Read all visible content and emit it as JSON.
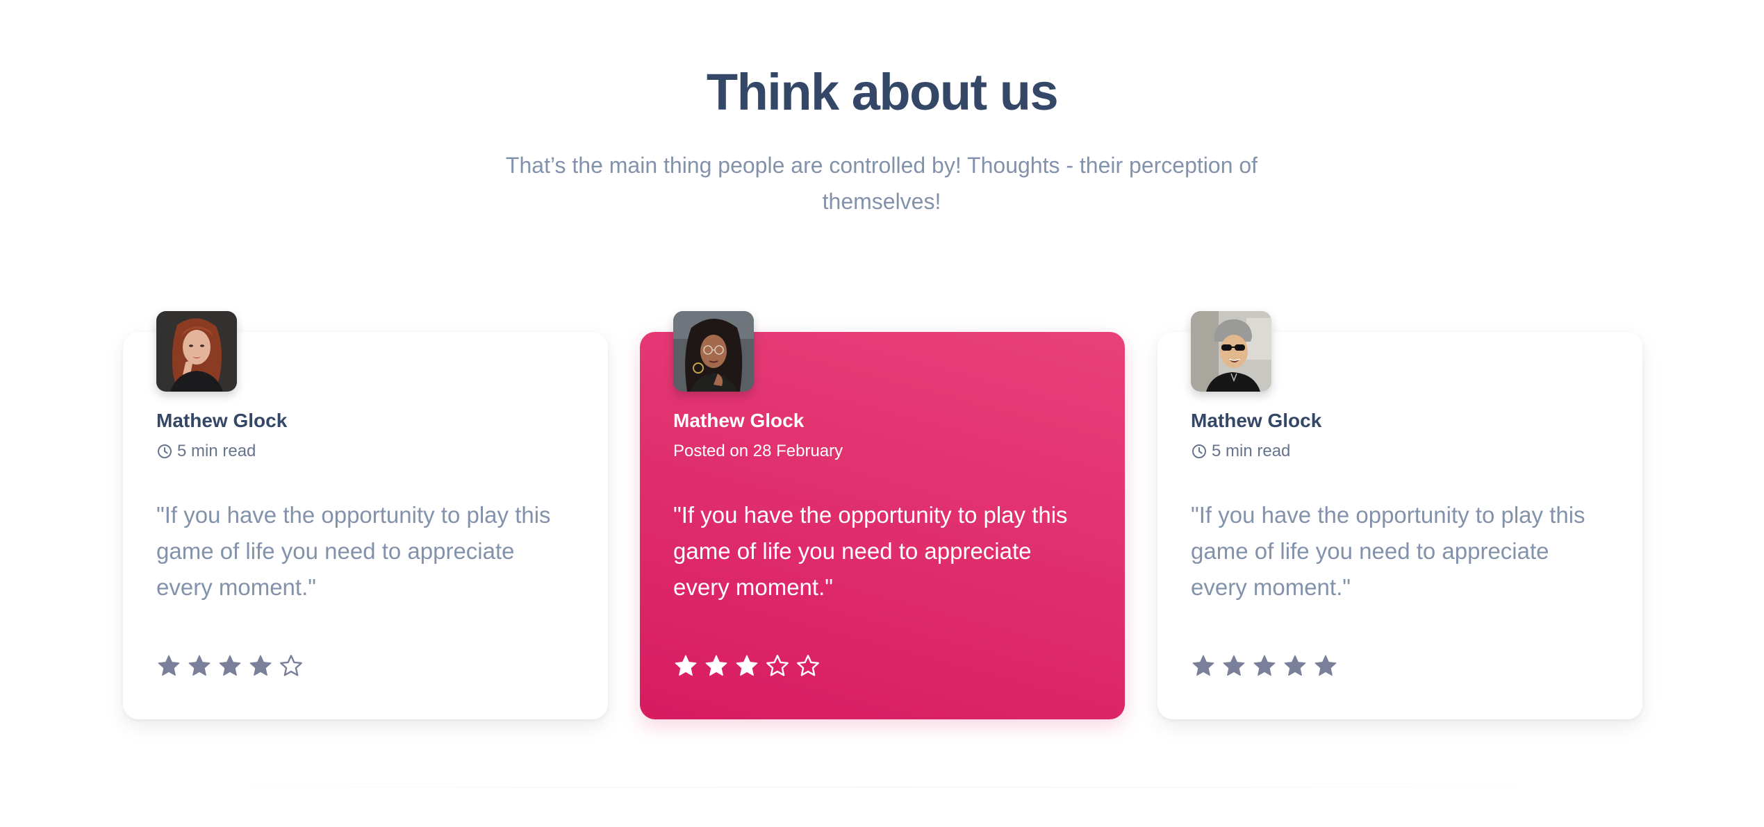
{
  "section": {
    "title": "Think about us",
    "subtitle": "That’s the main thing people are controlled by! Thoughts - their perception of themselves!"
  },
  "colors": {
    "heading": "#344767",
    "text_muted": "#8392ab",
    "accent_gradient_start": "#e8417a",
    "accent_gradient_end": "#d81b60",
    "star_filled": "#7b809a"
  },
  "testimonials": [
    {
      "author": "Mathew Glock",
      "meta_icon": "clock-icon",
      "meta": "5 min read",
      "quote": "\"If you have the opportunity to play this game of life you need to appreciate every moment.\"",
      "rating": 4,
      "rating_max": 5,
      "featured": false
    },
    {
      "author": "Mathew Glock",
      "meta_icon": "",
      "meta": "Posted on 28 February",
      "quote": "\"If you have the opportunity to play this game of life you need to appreciate every moment.\"",
      "rating": 3,
      "rating_max": 5,
      "featured": true
    },
    {
      "author": "Mathew Glock",
      "meta_icon": "clock-icon",
      "meta": "5 min read",
      "quote": "\"If you have the opportunity to play this game of life you need to appreciate every moment.\"",
      "rating": 5,
      "rating_max": 5,
      "featured": false
    }
  ]
}
